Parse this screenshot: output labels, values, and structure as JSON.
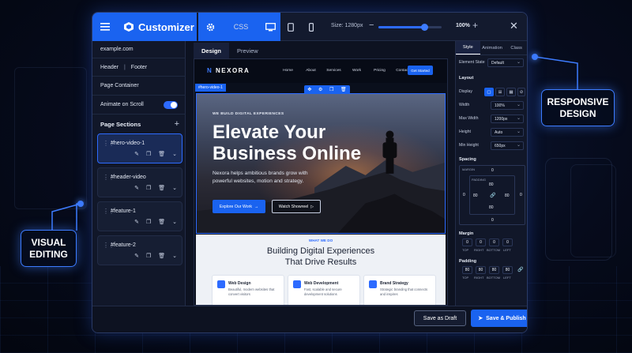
{
  "app": {
    "brand": "Customizer",
    "tab_css": "CSS"
  },
  "toolbar": {
    "size_label": "Size: 1280px",
    "zoom": "100%",
    "minus": "−",
    "plus": "+",
    "close": "✕",
    "zoom_fraction": 0.72
  },
  "callouts": {
    "left": "VISUAL\nEDITING",
    "right": "RESPONSIVE\nDESIGN"
  },
  "sidebar": {
    "domain": "example.com",
    "header": "Header",
    "sep": "|",
    "footer": "Footer",
    "page_container": "Page Container",
    "animate": "Animate on Scroll",
    "animate_on": true,
    "page_sections": "Page Sections",
    "add": "+",
    "sections": [
      {
        "name": "#hero-video-1",
        "active": true
      },
      {
        "name": "#header-video",
        "active": false
      },
      {
        "name": "#feature-1",
        "active": false
      },
      {
        "name": "#feature-2",
        "active": false
      }
    ]
  },
  "canvas": {
    "tabs": [
      "Design",
      "Preview"
    ],
    "logo": "NEXORA",
    "nav": [
      "Home",
      "About",
      "Services",
      "Work",
      "Pricing",
      "Contact"
    ],
    "cta": "Get Started",
    "selected_tag": "#hero-video-1",
    "hero": {
      "kicker": "WE BUILD DIGITAL EXPERIENCES",
      "title": "Elevate Your Business Online",
      "desc": "Nexora helps ambitious brands grow with powerful websites, motion and strategy.",
      "btn_primary": "Explore Our Work",
      "btn_secondary": "Watch Showreel"
    },
    "features": {
      "kicker": "WHAT WE DO",
      "title": "Building Digital Experiences That Drive Results",
      "cards": [
        {
          "title": "Web Design",
          "desc": "Beautiful, modern websites that convert visitors"
        },
        {
          "title": "Web Development",
          "desc": "Fast, scalable and secure development solutions"
        },
        {
          "title": "Brand Strategy",
          "desc": "Strategic branding that connects and inspires"
        }
      ]
    }
  },
  "inspector": {
    "tabs": [
      "Style",
      "Animation",
      "Class"
    ],
    "element_state_label": "Element State",
    "element_state": "Default",
    "layout": "Layout",
    "display": "Display",
    "width_label": "Width",
    "width": "100%",
    "max_width_label": "Max Width",
    "max_width": "1200px",
    "height_label": "Height",
    "height": "Auto",
    "min_height_label": "Min Height",
    "min_height": "650px",
    "spacing": "Spacing",
    "margin_box_label": "MARGIN",
    "padding_box_label": "PADDING",
    "spacing_values": {
      "m_left": "0",
      "m_right": "0",
      "m_top": "0",
      "m_bottom": "0",
      "p_top": "80",
      "p_left": "80",
      "p_right": "80",
      "p_bottom": "80"
    },
    "margin": "Margin",
    "margin_values": [
      "0",
      "0",
      "0",
      "0"
    ],
    "padding": "Padding",
    "padding_values": [
      "80",
      "80",
      "80",
      "80"
    ],
    "sides": [
      "TOP",
      "RIGHT",
      "BOTTOM",
      "LEFT"
    ]
  },
  "footer": {
    "draft": "Save as Draft",
    "publish": "Save & Publish"
  }
}
